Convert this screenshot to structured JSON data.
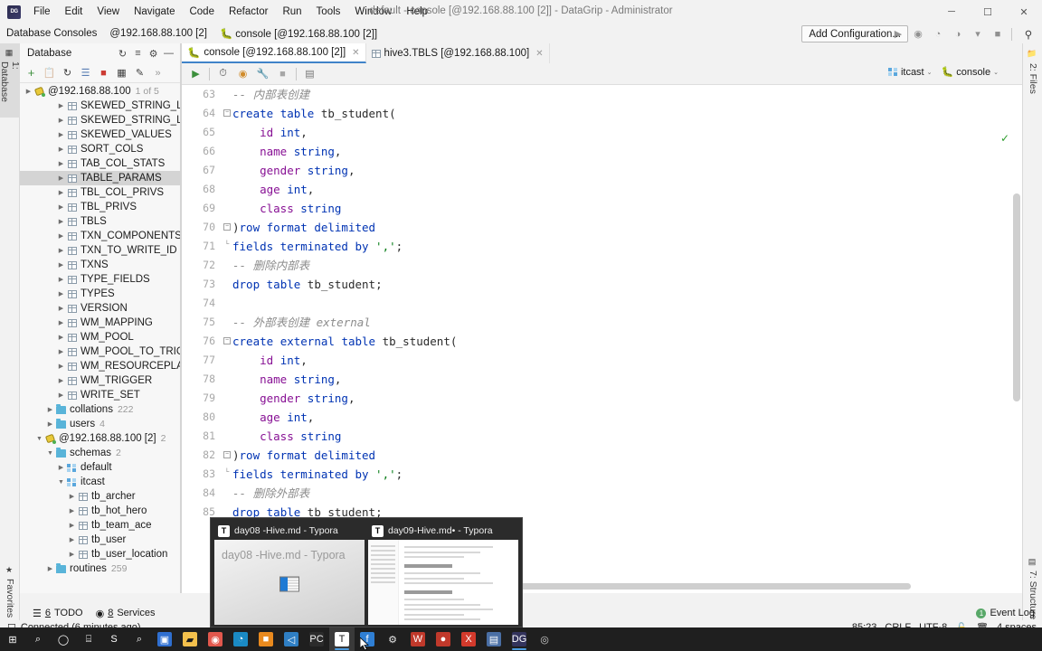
{
  "window": {
    "title": "default - console [@192.168.88.100 [2]] - DataGrip - Administrator",
    "logo": "DG",
    "minimize": "─",
    "maximize": "☐",
    "close": "✕"
  },
  "menu": [
    "File",
    "Edit",
    "View",
    "Navigate",
    "Code",
    "Refactor",
    "Run",
    "Tools",
    "Window",
    "Help"
  ],
  "breadcrumb": {
    "root": "Database Consoles",
    "server": "@192.168.88.100 [2]",
    "console": "console [@192.168.88.100 [2]]"
  },
  "toolbar": {
    "add_configuration": "Add Configuration...",
    "run": "▶",
    "debug": "◉",
    "run_coverage": "◔",
    "profile": "◑",
    "dropdown": "▾",
    "stop": "■",
    "search": "⚲"
  },
  "left_tabs": [
    {
      "label": "1: Database",
      "icon": "database-icon",
      "active": true
    },
    {
      "label": "Favorites",
      "icon": "star-icon",
      "active": false
    }
  ],
  "right_tabs": [
    {
      "label": "2: Files",
      "icon": "folder-icon"
    },
    {
      "label": "7: Structure",
      "icon": "structure-icon"
    }
  ],
  "db_panel": {
    "title": "Database",
    "header_icons": [
      "sync-icon",
      "collapse-all-icon",
      "gear-icon",
      "hide-icon"
    ],
    "toolbar_icons": [
      "add-icon",
      "copy-icon",
      "refresh-icon",
      "run-query-icon",
      "stop-icon",
      "table-icon",
      "edit-icon",
      "more-icon"
    ],
    "connection": {
      "label": "@192.168.88.100",
      "badge": "1 of 5"
    },
    "tree": [
      {
        "label": "SKEWED_STRING_LIS",
        "icon": "table-icon",
        "indent": 3,
        "arrow": true
      },
      {
        "label": "SKEWED_STRING_LIS",
        "icon": "table-icon",
        "indent": 3,
        "arrow": true
      },
      {
        "label": "SKEWED_VALUES",
        "icon": "table-icon",
        "indent": 3,
        "arrow": true
      },
      {
        "label": "SORT_COLS",
        "icon": "table-icon",
        "indent": 3,
        "arrow": true
      },
      {
        "label": "TAB_COL_STATS",
        "icon": "table-icon",
        "indent": 3,
        "arrow": true
      },
      {
        "label": "TABLE_PARAMS",
        "icon": "table-icon",
        "indent": 3,
        "arrow": true,
        "selected": true
      },
      {
        "label": "TBL_COL_PRIVS",
        "icon": "table-icon",
        "indent": 3,
        "arrow": true
      },
      {
        "label": "TBL_PRIVS",
        "icon": "table-icon",
        "indent": 3,
        "arrow": true
      },
      {
        "label": "TBLS",
        "icon": "table-icon",
        "indent": 3,
        "arrow": true
      },
      {
        "label": "TXN_COMPONENTS",
        "icon": "table-icon",
        "indent": 3,
        "arrow": true
      },
      {
        "label": "TXN_TO_WRITE_ID",
        "icon": "table-icon",
        "indent": 3,
        "arrow": true
      },
      {
        "label": "TXNS",
        "icon": "table-icon",
        "indent": 3,
        "arrow": true
      },
      {
        "label": "TYPE_FIELDS",
        "icon": "table-icon",
        "indent": 3,
        "arrow": true
      },
      {
        "label": "TYPES",
        "icon": "table-icon",
        "indent": 3,
        "arrow": true
      },
      {
        "label": "VERSION",
        "icon": "table-icon",
        "indent": 3,
        "arrow": true
      },
      {
        "label": "WM_MAPPING",
        "icon": "table-icon",
        "indent": 3,
        "arrow": true
      },
      {
        "label": "WM_POOL",
        "icon": "table-icon",
        "indent": 3,
        "arrow": true
      },
      {
        "label": "WM_POOL_TO_TRIGG",
        "icon": "table-icon",
        "indent": 3,
        "arrow": true
      },
      {
        "label": "WM_RESOURCEPLAN",
        "icon": "table-icon",
        "indent": 3,
        "arrow": true
      },
      {
        "label": "WM_TRIGGER",
        "icon": "table-icon",
        "indent": 3,
        "arrow": true
      },
      {
        "label": "WRITE_SET",
        "icon": "table-icon",
        "indent": 3,
        "arrow": true
      },
      {
        "label": "collations",
        "count": "222",
        "icon": "folder-icon",
        "indent": 2,
        "arrow": true
      },
      {
        "label": "users",
        "count": "4",
        "icon": "folder-icon",
        "indent": 2,
        "arrow": true
      },
      {
        "label": "@192.168.88.100 [2]",
        "count": "2",
        "icon": "db-icon",
        "indent": 1,
        "arrow": true,
        "expanded": true
      },
      {
        "label": "schemas",
        "count": "2",
        "icon": "folder-icon",
        "indent": 2,
        "arrow": true,
        "expanded": true
      },
      {
        "label": "default",
        "icon": "schema-icon",
        "indent": 3,
        "arrow": true
      },
      {
        "label": "itcast",
        "icon": "schema-icon",
        "indent": 3,
        "arrow": true,
        "expanded": true
      },
      {
        "label": "tb_archer",
        "icon": "table-icon",
        "indent": 4,
        "arrow": true
      },
      {
        "label": "tb_hot_hero",
        "icon": "table-icon",
        "indent": 4,
        "arrow": true
      },
      {
        "label": "tb_team_ace",
        "icon": "table-icon",
        "indent": 4,
        "arrow": true
      },
      {
        "label": "tb_user",
        "icon": "table-icon",
        "indent": 4,
        "arrow": true
      },
      {
        "label": "tb_user_location",
        "icon": "table-icon",
        "indent": 4,
        "arrow": true
      },
      {
        "label": "routines",
        "count": "259",
        "icon": "folder-icon",
        "indent": 2,
        "arrow": true
      }
    ]
  },
  "editor": {
    "tabs": [
      {
        "label": "console [@192.168.88.100 [2]]",
        "icon": "console-icon",
        "active": true,
        "close": "✕"
      },
      {
        "label": "hive3.TBLS [@192.168.88.100]",
        "icon": "table-icon",
        "active": false,
        "close": "✕"
      }
    ],
    "toolbar_icons": [
      "execute-icon",
      "history-icon",
      "params-icon",
      "wrench-icon",
      "stop-icon",
      "grid-icon"
    ],
    "context": {
      "schema": "itcast",
      "session": "console",
      "chevron": "⌄"
    },
    "first_line_number": 63,
    "lines": [
      {
        "n": 63,
        "tokens": [
          {
            "t": "-- 内部表创建",
            "c": "cm"
          }
        ]
      },
      {
        "n": 64,
        "fold": "minus",
        "tokens": [
          {
            "t": "create",
            "c": "kw"
          },
          {
            "t": " ",
            "c": "pl"
          },
          {
            "t": "table",
            "c": "kw"
          },
          {
            "t": " tb_student(",
            "c": "id"
          }
        ]
      },
      {
        "n": 65,
        "tokens": [
          {
            "t": "    ",
            "c": "pl"
          },
          {
            "t": "id",
            "c": "col"
          },
          {
            "t": " ",
            "c": "pl"
          },
          {
            "t": "int",
            "c": "typ"
          },
          {
            "t": ",",
            "c": "id"
          }
        ]
      },
      {
        "n": 66,
        "tokens": [
          {
            "t": "    ",
            "c": "pl"
          },
          {
            "t": "name",
            "c": "col"
          },
          {
            "t": " ",
            "c": "pl"
          },
          {
            "t": "string",
            "c": "typ"
          },
          {
            "t": ",",
            "c": "id"
          }
        ]
      },
      {
        "n": 67,
        "tokens": [
          {
            "t": "    ",
            "c": "pl"
          },
          {
            "t": "gender",
            "c": "col"
          },
          {
            "t": " ",
            "c": "pl"
          },
          {
            "t": "string",
            "c": "typ"
          },
          {
            "t": ",",
            "c": "id"
          }
        ]
      },
      {
        "n": 68,
        "tokens": [
          {
            "t": "    ",
            "c": "pl"
          },
          {
            "t": "age",
            "c": "col"
          },
          {
            "t": " ",
            "c": "pl"
          },
          {
            "t": "int",
            "c": "typ"
          },
          {
            "t": ",",
            "c": "id"
          }
        ]
      },
      {
        "n": 69,
        "tokens": [
          {
            "t": "    ",
            "c": "pl"
          },
          {
            "t": "class",
            "c": "col"
          },
          {
            "t": " ",
            "c": "pl"
          },
          {
            "t": "string",
            "c": "typ"
          }
        ]
      },
      {
        "n": 70,
        "fold": "end",
        "tokens": [
          {
            "t": ")",
            "c": "id"
          },
          {
            "t": "row format delimited",
            "c": "kw"
          }
        ]
      },
      {
        "n": 71,
        "fold": "tick",
        "tokens": [
          {
            "t": "fields terminated by ",
            "c": "kw"
          },
          {
            "t": "','",
            "c": "str"
          },
          {
            "t": ";",
            "c": "id"
          }
        ]
      },
      {
        "n": 72,
        "tokens": [
          {
            "t": "-- 删除内部表",
            "c": "cm"
          }
        ]
      },
      {
        "n": 73,
        "tokens": [
          {
            "t": "drop",
            "c": "kw"
          },
          {
            "t": " ",
            "c": "pl"
          },
          {
            "t": "table",
            "c": "kw"
          },
          {
            "t": " tb_student;",
            "c": "id"
          }
        ]
      },
      {
        "n": 74,
        "tokens": [
          {
            "t": "",
            "c": "pl"
          }
        ]
      },
      {
        "n": 75,
        "tokens": [
          {
            "t": "-- 外部表创建 external",
            "c": "cm"
          }
        ]
      },
      {
        "n": 76,
        "fold": "minus",
        "tokens": [
          {
            "t": "create",
            "c": "kw"
          },
          {
            "t": " ",
            "c": "pl"
          },
          {
            "t": "external",
            "c": "kw"
          },
          {
            "t": " ",
            "c": "pl"
          },
          {
            "t": "table",
            "c": "kw"
          },
          {
            "t": " tb_student(",
            "c": "id"
          }
        ]
      },
      {
        "n": 77,
        "tokens": [
          {
            "t": "    ",
            "c": "pl"
          },
          {
            "t": "id",
            "c": "col"
          },
          {
            "t": " ",
            "c": "pl"
          },
          {
            "t": "int",
            "c": "typ"
          },
          {
            "t": ",",
            "c": "id"
          }
        ]
      },
      {
        "n": 78,
        "tokens": [
          {
            "t": "    ",
            "c": "pl"
          },
          {
            "t": "name",
            "c": "col"
          },
          {
            "t": " ",
            "c": "pl"
          },
          {
            "t": "string",
            "c": "typ"
          },
          {
            "t": ",",
            "c": "id"
          }
        ]
      },
      {
        "n": 79,
        "tokens": [
          {
            "t": "    ",
            "c": "pl"
          },
          {
            "t": "gender",
            "c": "col"
          },
          {
            "t": " ",
            "c": "pl"
          },
          {
            "t": "string",
            "c": "typ"
          },
          {
            "t": ",",
            "c": "id"
          }
        ]
      },
      {
        "n": 80,
        "tokens": [
          {
            "t": "    ",
            "c": "pl"
          },
          {
            "t": "age",
            "c": "col"
          },
          {
            "t": " ",
            "c": "pl"
          },
          {
            "t": "int",
            "c": "typ"
          },
          {
            "t": ",",
            "c": "id"
          }
        ]
      },
      {
        "n": 81,
        "tokens": [
          {
            "t": "    ",
            "c": "pl"
          },
          {
            "t": "class",
            "c": "col"
          },
          {
            "t": " ",
            "c": "pl"
          },
          {
            "t": "string",
            "c": "typ"
          }
        ]
      },
      {
        "n": 82,
        "fold": "end",
        "tokens": [
          {
            "t": ")",
            "c": "id"
          },
          {
            "t": "row format delimited",
            "c": "kw"
          }
        ]
      },
      {
        "n": 83,
        "fold": "tick",
        "tokens": [
          {
            "t": "fields terminated by ",
            "c": "kw"
          },
          {
            "t": "','",
            "c": "str"
          },
          {
            "t": ";",
            "c": "id"
          }
        ]
      },
      {
        "n": 84,
        "tokens": [
          {
            "t": "-- 删除外部表",
            "c": "cm"
          }
        ]
      },
      {
        "n": 85,
        "tokens": [
          {
            "t": "drop",
            "c": "kw"
          },
          {
            "t": " ",
            "c": "pl"
          },
          {
            "t": "table",
            "c": "kw"
          },
          {
            "t": " tb_student;",
            "c": "id"
          }
        ]
      }
    ]
  },
  "tool_windows": [
    {
      "key": "6",
      "label": "TODO",
      "icon": "todo-icon"
    },
    {
      "key": "8",
      "label": "Services",
      "icon": "services-icon"
    }
  ],
  "status": {
    "connection": "Connected (6 minutes ago)",
    "caret": "85:23",
    "line_sep": "CRLF",
    "encoding": "UTF-8",
    "lock": "lock-icon",
    "indent": "4 spaces",
    "event_log": "Event Log",
    "event_count": "1"
  },
  "thumbnails": [
    {
      "title": "day08 -Hive.md - Typora",
      "icon": "T",
      "ghost": "day08 -Hive.md - Typora",
      "selected": true
    },
    {
      "title": "day09-Hive.md• - Typora",
      "icon": "T",
      "selected": false
    }
  ],
  "taskbar": [
    {
      "name": "start-button",
      "glyph": "⊞",
      "color": "#ffffff",
      "bg": "transparent"
    },
    {
      "name": "search-icon",
      "glyph": "⌕",
      "color": "#ffffff",
      "bg": "transparent"
    },
    {
      "name": "cortana-icon",
      "glyph": "◯",
      "color": "#ffffff",
      "bg": "transparent"
    },
    {
      "name": "task-view-icon",
      "glyph": "⌸",
      "color": "#ffffff",
      "bg": "transparent"
    },
    {
      "name": "snipaste-icon",
      "glyph": "S",
      "color": "#ffffff",
      "bg": "transparent"
    },
    {
      "name": "everything-icon",
      "glyph": "⌕",
      "color": "#ffffff",
      "bg": "transparent"
    },
    {
      "name": "app-store-icon",
      "glyph": "▣",
      "color": "#ffffff",
      "bg": "#2f6fd0"
    },
    {
      "name": "file-explorer-icon",
      "glyph": "▰",
      "color": "#1a1a1a",
      "bg": "#f3c04c"
    },
    {
      "name": "chrome-icon",
      "glyph": "◉",
      "color": "#ffffff",
      "bg": "#e2584d"
    },
    {
      "name": "edge-icon",
      "glyph": "◔",
      "color": "#ffffff",
      "bg": "#1a8ac4"
    },
    {
      "name": "qq-browser-icon",
      "glyph": "■",
      "color": "#ffffff",
      "bg": "#e98a1e"
    },
    {
      "name": "vscode-icon",
      "glyph": "◁",
      "color": "#ffffff",
      "bg": "#2f7fc4"
    },
    {
      "name": "pycharm-icon",
      "glyph": "PC",
      "color": "#f4f4f4",
      "bg": "#2b2b2b"
    },
    {
      "name": "typora-icon",
      "glyph": "T",
      "color": "#1a1a1a",
      "bg": "#ffffff",
      "active": true,
      "running": true
    },
    {
      "name": "feishu-icon",
      "glyph": "f",
      "color": "#ffffff",
      "bg": "#2f7fd4"
    },
    {
      "name": "settings-icon",
      "glyph": "⚙",
      "color": "#e4e4e4",
      "bg": "transparent"
    },
    {
      "name": "wps-icon",
      "glyph": "W",
      "color": "#ffffff",
      "bg": "#c0392b"
    },
    {
      "name": "360-icon",
      "glyph": "●",
      "color": "#ffffff",
      "bg": "#c0392b"
    },
    {
      "name": "xmind-icon",
      "glyph": "X",
      "color": "#ffffff",
      "bg": "#d33a2c"
    },
    {
      "name": "vmware-icon",
      "glyph": "▤",
      "color": "#ffffff",
      "bg": "#4a6fa5"
    },
    {
      "name": "datagrip-icon",
      "glyph": "DG",
      "color": "#ffffff",
      "bg": "#33335c",
      "running": true
    },
    {
      "name": "other-app-icon",
      "glyph": "◎",
      "color": "#cfcfcf",
      "bg": "transparent"
    }
  ]
}
